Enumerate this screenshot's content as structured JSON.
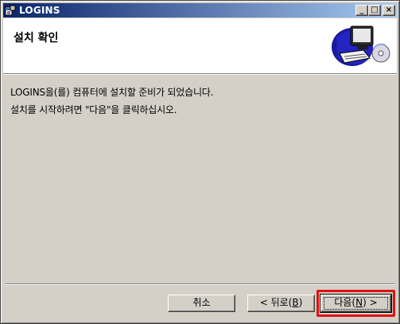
{
  "window": {
    "title": "LOGINS",
    "minimize_glyph": "_",
    "maximize_glyph": "□",
    "close_glyph": "×"
  },
  "header": {
    "title": "설치 확인",
    "illustration": "computer-with-cd-icon"
  },
  "body": {
    "line1": "LOGINS을(를) 컴퓨터에 설치할 준비가 되었습니다.",
    "line2": "설치를 시작하려면 \"다음\"을 클릭하십시오."
  },
  "buttons": {
    "cancel": "취소",
    "back_prefix": "< 뒤로(",
    "back_key": "B",
    "back_suffix": ")",
    "next_prefix": "다음(",
    "next_key": "N",
    "next_suffix": ") >"
  },
  "colors": {
    "dialog_face": "#d4d0c8",
    "title_gradient_start": "#0a246a",
    "title_gradient_end": "#a6caf0",
    "highlight_box": "#e01010"
  }
}
